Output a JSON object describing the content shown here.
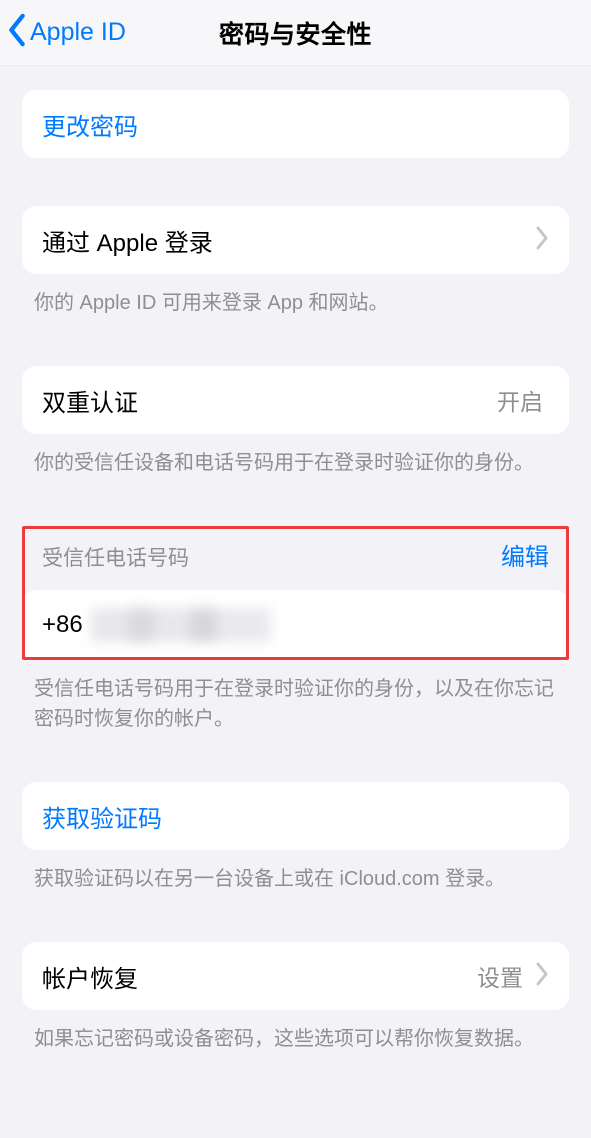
{
  "nav": {
    "back_label": "Apple ID",
    "title": "密码与安全性"
  },
  "change_password": {
    "label": "更改密码"
  },
  "sign_in_with_apple": {
    "label": "通过 Apple 登录",
    "caption": "你的 Apple ID 可用来登录 App 和网站。"
  },
  "twofa": {
    "label": "双重认证",
    "value": "开启",
    "caption": "你的受信任设备和电话号码用于在登录时验证你的身份。"
  },
  "trusted_phone": {
    "header": "受信任电话号码",
    "edit": "编辑",
    "country_code": "+86",
    "caption": "受信任电话号码用于在登录时验证你的身份，以及在你忘记密码时恢复你的帐户。"
  },
  "get_code": {
    "label": "获取验证码",
    "caption": "获取验证码以在另一台设备上或在 iCloud.com 登录。"
  },
  "recovery": {
    "label": "帐户恢复",
    "value": "设置",
    "caption": "如果忘记密码或设备密码，这些选项可以帮你恢复数据。"
  }
}
